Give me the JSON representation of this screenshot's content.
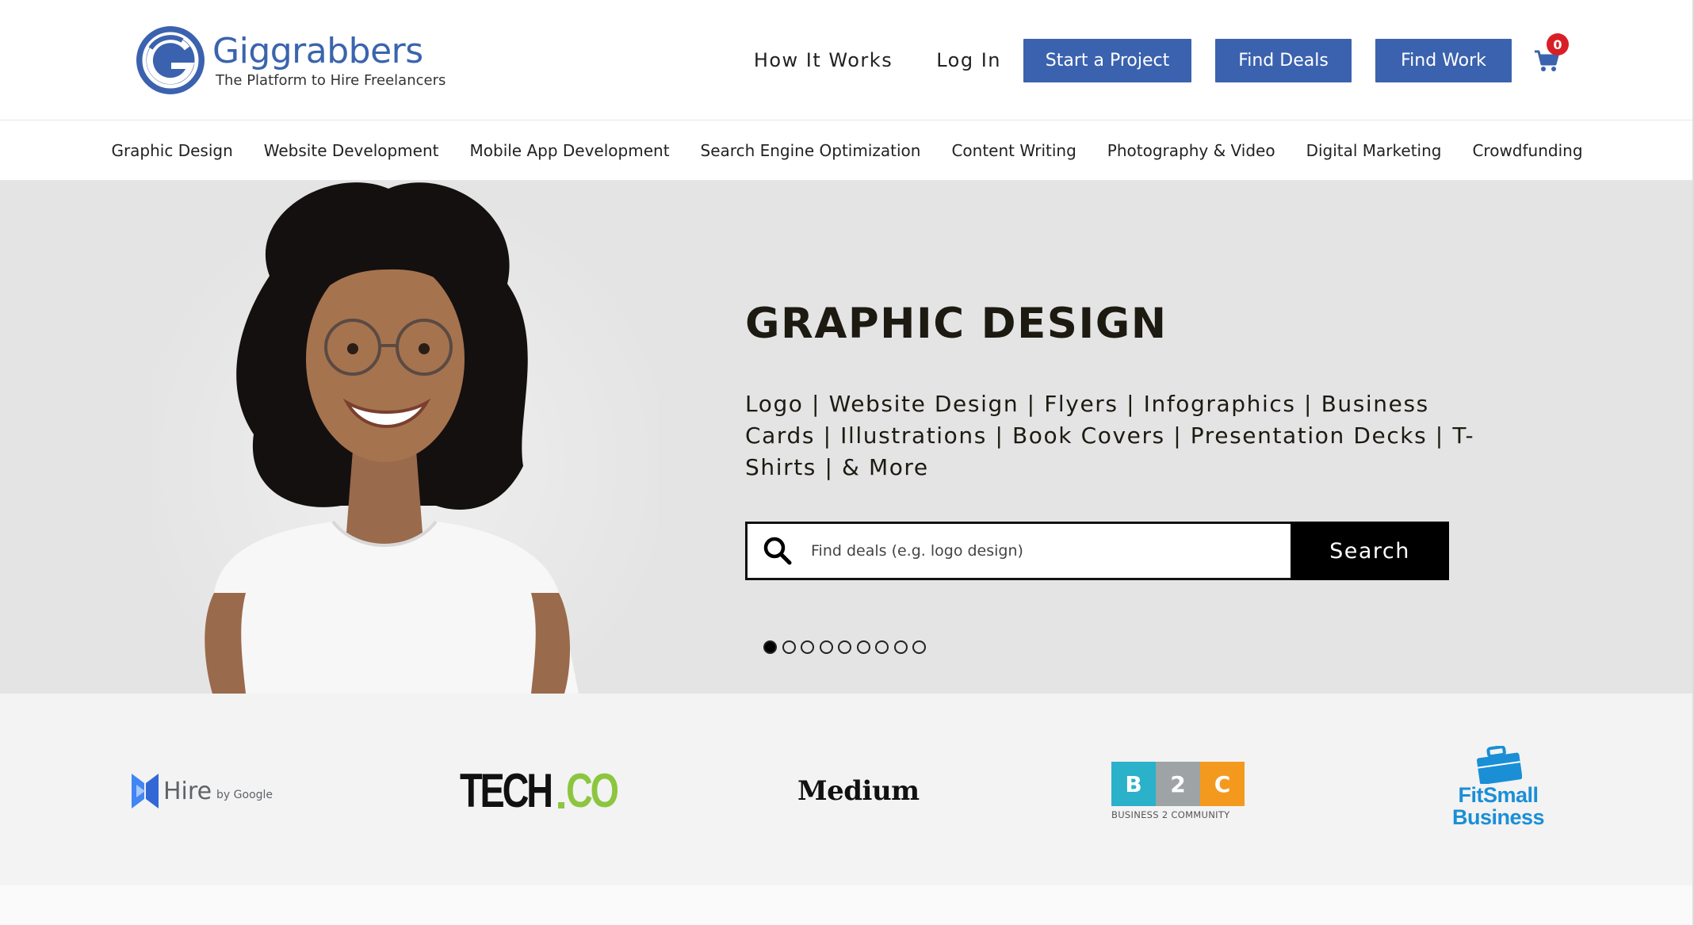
{
  "header": {
    "logo": {
      "name": "Giggrabbers",
      "tagline": "The Platform to Hire Freelancers"
    },
    "nav": {
      "how_it_works": "How It Works",
      "log_in": "Log In"
    },
    "buttons": {
      "start_project": "Start a Project",
      "find_deals": "Find Deals",
      "find_work": "Find Work"
    },
    "cart": {
      "count": "0",
      "icon": "shopping-cart-icon"
    }
  },
  "categories": [
    "Graphic Design",
    "Website Development",
    "Mobile App Development",
    "Search Engine Optimization",
    "Content Writing",
    "Photography & Video",
    "Digital Marketing",
    "Crowdfunding"
  ],
  "hero": {
    "title": "GRAPHIC DESIGN",
    "subtitle": "Logo | Website Design | Flyers | Infographics | Business Cards | Illustrations | Book Covers | Presentation Decks | T-Shirts | & More",
    "search": {
      "placeholder": "Find deals (e.g. logo design)",
      "value": "",
      "button": "Search",
      "icon": "search-icon"
    },
    "slides": {
      "count": 9,
      "active_index": 0
    }
  },
  "press": {
    "hire": {
      "main": "Hire",
      "suffix": "by Google"
    },
    "techco": {
      "tech": "TECH",
      "co": "CO"
    },
    "medium": "Medium",
    "b2c": {
      "letters": [
        "B",
        "2",
        "C"
      ],
      "caption": "BUSINESS 2 COMMUNITY"
    },
    "fitsmall": {
      "line1": "FitSmall",
      "line2": "Business"
    }
  },
  "colors": {
    "brand_blue": "#3b62ae",
    "cart_badge": "#d91f26",
    "hero_bg": "#e4e4e4",
    "techco_green": "#8cc63f",
    "fitsmall_blue": "#1a8fd6"
  }
}
